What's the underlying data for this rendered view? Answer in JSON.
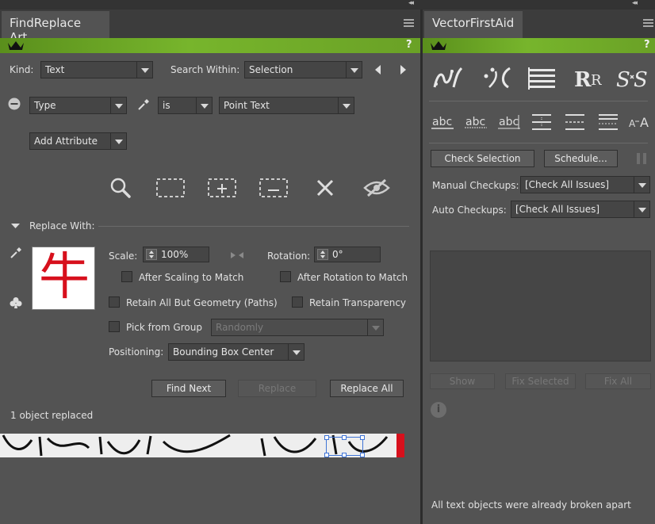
{
  "left_panel": {
    "tab_title": "FindReplace Art",
    "help_label": "?",
    "kind_label": "Kind:",
    "kind_value": "Text",
    "search_within_label": "Search Within:",
    "search_within_value": "Selection",
    "criteria": {
      "attribute": "Type",
      "operator": "is",
      "value": "Point Text"
    },
    "add_attribute_label": "Add Attribute",
    "replace_with_label": "Replace With:",
    "preview_glyph": "牛",
    "scale_label": "Scale:",
    "scale_value": "100%",
    "rotation_label": "Rotation:",
    "rotation_value": "0°",
    "after_scaling_label": "After Scaling to Match",
    "after_rotation_label": "After Rotation to Match",
    "retain_geometry_label": "Retain All But Geometry (Paths)",
    "retain_transparency_label": "Retain Transparency",
    "pick_from_group_label": "Pick from Group",
    "pick_from_group_value": "Randomly",
    "positioning_label": "Positioning:",
    "positioning_value": "Bounding Box Center",
    "find_next_label": "Find Next",
    "replace_label": "Replace",
    "replace_all_label": "Replace All",
    "status_text": "1 object replaced"
  },
  "right_panel": {
    "tab_title": "VectorFirstAid",
    "help_label": "?",
    "check_selection_label": "Check Selection",
    "schedule_label": "Schedule...",
    "manual_checkups_label": "Manual Checkups:",
    "manual_checkups_value": "[Check All Issues]",
    "auto_checkups_label": "Auto Checkups:",
    "auto_checkups_value": "[Check All Issues]",
    "show_label": "Show",
    "fix_selected_label": "Fix Selected",
    "fix_all_label": "Fix All",
    "info_icon_label": "i",
    "status_text": "All text objects were already broken apart"
  },
  "colors": {
    "panel_bg": "#535353",
    "header_green": "#77b52c",
    "preview_red": "#d7101c"
  }
}
